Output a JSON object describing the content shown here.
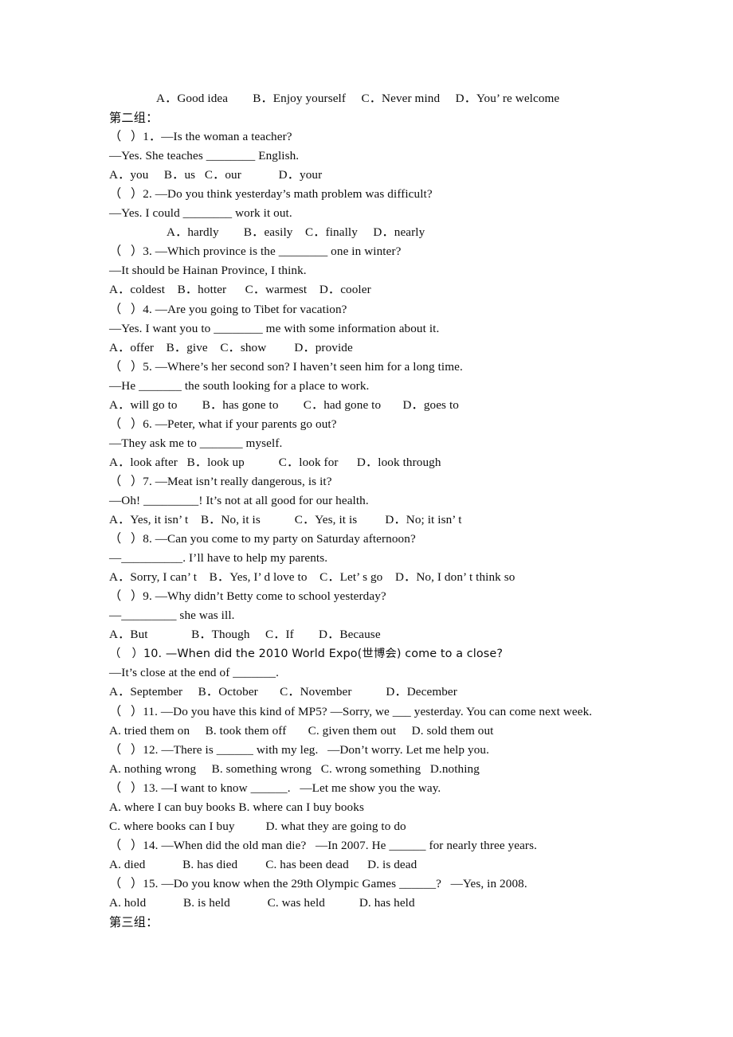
{
  "document": {
    "type": "english-multiple-choice-worksheet",
    "page_background": "#ffffff",
    "text_color": "#0d0d0d",
    "lines": [
      "A．Good idea        B．Enjoy yourself     C．Never mind     D．You’ re welcome",
      "第二组：",
      "（   ）1．—Is the woman a teacher?",
      "—Yes. She teaches ________ English.",
      "A．you     B．us   C．our            D．your",
      "（   ）2. —Do you think yesterday’s math problem was difficult?",
      "—Yes. I could ________ work it out.",
      "A．hardly        B．easily    C．finally     D．nearly",
      "（   ）3. —Which province is the ________ one in winter?",
      "—It should be Hainan Province, I think.",
      "A．coldest    B．hotter      C．warmest    D．cooler",
      "（   ）4. —Are you going to Tibet for vacation?",
      "—Yes. I want you to ________ me with some information about it.",
      "A．offer    B．give    C．show         D．provide",
      "（   ）5. —Where’s her second son? I haven’t seen him for a long time.",
      "—He _______ the south looking for a place to work.",
      "A．will go to        B．has gone to        C．had gone to       D．goes to",
      "（   ）6. —Peter, what if your parents go out?",
      "—They ask me to _______ myself.",
      "A．look after   B．look up           C．look for      D．look through",
      "（   ）7. —Meat isn’t really dangerous, is it?",
      "—Oh! _________! It’s not at all good for our health.",
      "A．Yes, it isn’ t    B．No, it is           C．Yes, it is         D．No; it isn’ t",
      "（   ）8. —Can you come to my party on Saturday afternoon?",
      "—__________. I’ll have to help my parents.",
      "A．Sorry, I can’ t    B．Yes, I’ d love to    C．Let’ s go    D．No, I don’ t think so",
      "（   ）9. —Why didn’t Betty come to school yesterday?",
      "—_________ she was ill.",
      "A．But              B．Though     C．If        D．Because",
      "（   ）10. —When did the 2010 World Expo(世博会) come to a close?",
      "—It’s close at the end of _______.",
      "A．September     B．October       C．November           D．December",
      "（   ）11. —Do you have this kind of MP5? —Sorry, we ___ yesterday. You can come next week.",
      "A. tried them on     B. took them off       C. given them out     D. sold them out",
      "（   ）12. —There is ______ with my leg.   —Don’t worry. Let me help you.",
      "A. nothing wrong     B. something wrong   C. wrong something   D.nothing",
      "（   ）13. —I want to know ______.   —Let me show you the way.",
      "A. where I can buy books B. where can I buy books",
      "C. where books can I buy          D. what they are going to do",
      "（   ）14. —When did the old man die?   —In 2007. He ______ for nearly three years.",
      "A. died            B. has died         C. has been dead      D. is dead",
      "（   ）15. —Do you know when the 29th Olympic Games ______?   —Yes, in 2008.",
      "A. hold            B. is held            C. was held           D. has held",
      "第三组："
    ],
    "line_styles": [
      "ind-1",
      "cn",
      "",
      "",
      "",
      "",
      "",
      "ind-2",
      "",
      "",
      "",
      "",
      "",
      "",
      "",
      "",
      "",
      "",
      "",
      "",
      "",
      "",
      "",
      "",
      "",
      "",
      "",
      "",
      "",
      "mixed",
      "",
      "",
      "",
      "",
      "",
      "",
      "",
      "",
      "",
      "",
      "",
      "",
      "",
      "cn"
    ],
    "sections": [
      {
        "label": "第二组：",
        "question_count": 15
      },
      {
        "label": "第三组：",
        "question_count": 0
      }
    ]
  }
}
